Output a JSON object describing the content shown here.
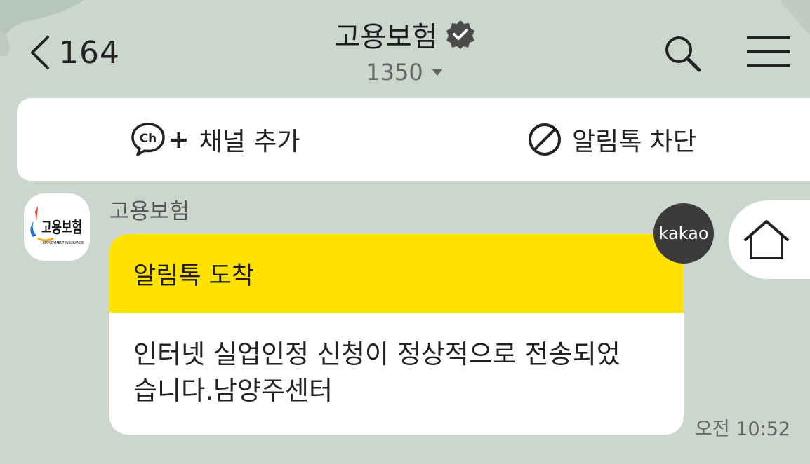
{
  "header": {
    "back_count": "164",
    "title": "고용보험",
    "subtitle": "1350"
  },
  "actions": {
    "add_channel_prefix": "+",
    "add_channel_label": "채널 추가",
    "channel_icon_text": "Ch",
    "block_label": "알림톡 차단"
  },
  "message": {
    "sender": "고용보험",
    "avatar_logo_text": "고용보험",
    "avatar_logo_sub": "EMPLOYMENT INSURANCE",
    "bubble_title": "알림톡 도착",
    "body_line1": "인터넷 실업인정 신청이 정상적으로 전송되었",
    "body_line2": "습니다.남양주센터",
    "time": "오전 10:52"
  },
  "badges": {
    "kakao": "kakao"
  },
  "colors": {
    "background": "#cbd6cf",
    "bubble_header": "#ffe200",
    "kakao_badge": "#3c3a3b"
  },
  "icons": [
    "chevron-left-icon",
    "verified-badge-icon",
    "caret-down-icon",
    "search-icon",
    "hamburger-menu-icon",
    "channel-icon",
    "block-icon",
    "home-icon"
  ]
}
